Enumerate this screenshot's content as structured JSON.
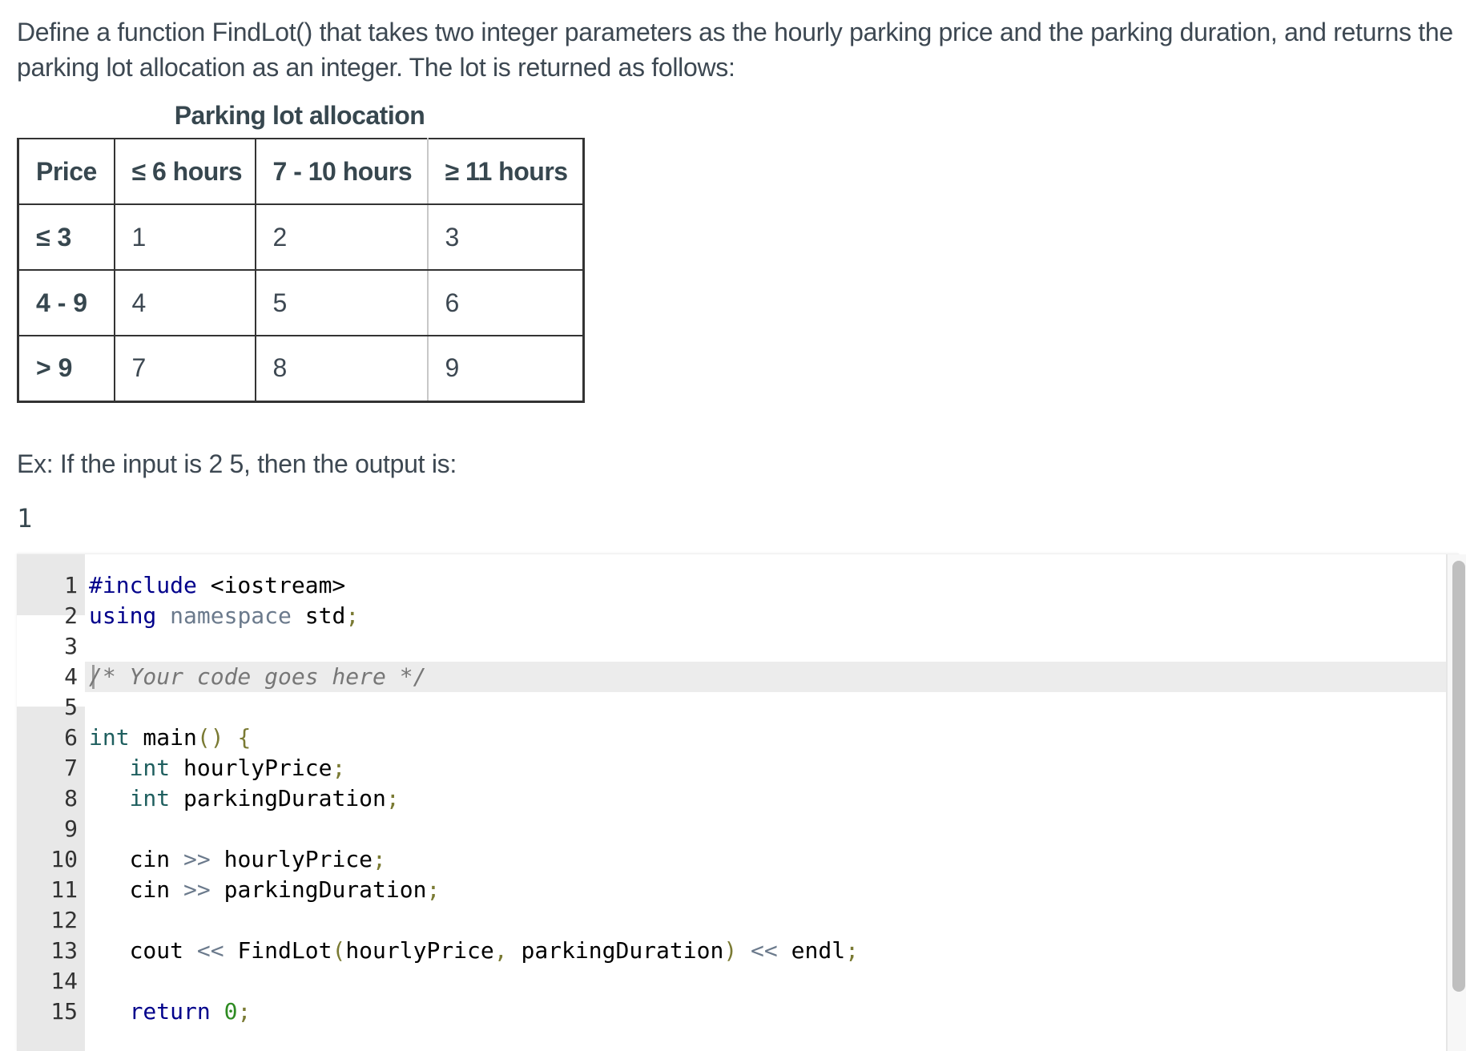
{
  "prompt": {
    "line1": "Define a function FindLot() that takes two integer parameters as the hourly parking price and the parking duration, and returns the",
    "line2": "parking lot allocation as an integer. The lot is returned as follows:"
  },
  "table": {
    "caption": "Parking lot allocation",
    "headers": [
      "Price",
      "≤ 6 hours",
      "7 - 10 hours",
      "≥ 11 hours"
    ],
    "rows": [
      {
        "price": "≤ 3",
        "values": [
          "1",
          "2",
          "3"
        ]
      },
      {
        "price": "4 - 9",
        "values": [
          "4",
          "5",
          "6"
        ]
      },
      {
        "price": "> 9",
        "values": [
          "7",
          "8",
          "9"
        ]
      }
    ]
  },
  "example": {
    "text": "Ex: If the input is 2 5, then the output is:",
    "output": "1"
  },
  "editor": {
    "line_numbers": [
      "1",
      "2",
      "3",
      "4",
      "5",
      "6",
      "7",
      "8",
      "9",
      "10",
      "11",
      "12",
      "13",
      "14",
      "15"
    ],
    "colors": {
      "keyword": "#00008b",
      "type": "#1f5f5f",
      "punctuation": "#7a7a33",
      "comment": "#777777",
      "number": "#2e8b22",
      "gutter": "#e8e8e8",
      "active_line": "#ececec"
    },
    "tokens": {
      "l1_kw": "#include",
      "l1_rest": " <iostream>",
      "l2_kw": "using",
      "l2_ns": " namespace",
      "l2_id": " std",
      "semi": ";",
      "l4_comment": "/* Your code goes here */",
      "int": "int",
      "main": " main",
      "parens": "()",
      "brace": " {",
      "indent": "   ",
      "hourlyPrice": " hourlyPrice",
      "parkingDuration": " parkingDuration",
      "cin": "cin",
      "shr": " >>",
      "cout": "cout",
      "shl": " <<",
      "findlot": " FindLot",
      "lparen": "(",
      "arg1": "hourlyPrice",
      "comma": ",",
      "arg2": " parkingDuration",
      "rparen": ")",
      "endl": " endl",
      "return": "return",
      "zero": " 0"
    }
  }
}
